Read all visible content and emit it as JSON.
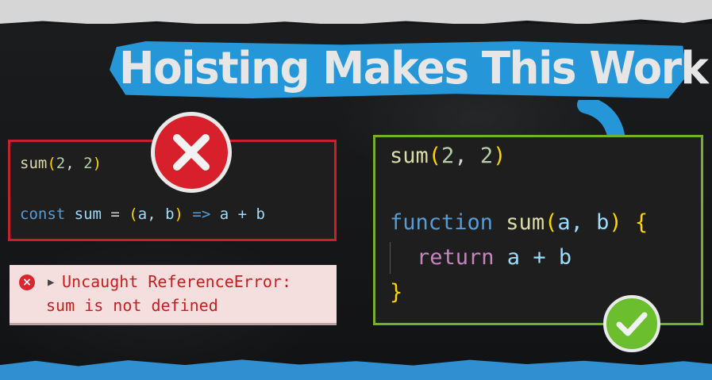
{
  "title": "Hoisting Makes This Work",
  "bad_code": {
    "line1": {
      "fn": "sum",
      "open": "(",
      "a": "2",
      "sep": ", ",
      "b": "2",
      "close": ")"
    },
    "line2": {
      "kw": "const",
      "name": " sum ",
      "eq": "= ",
      "open": "(",
      "p": "a, b",
      "close": ")",
      "arrow": " => ",
      "body": "a + b"
    }
  },
  "good_code": {
    "line1": {
      "fn": "sum",
      "open": "(",
      "a": "2",
      "sep": ", ",
      "b": "2",
      "close": ")"
    },
    "line2": {
      "kw": "function",
      "name": " sum",
      "open": "(",
      "p": "a, b",
      "close": ")",
      "brace": " {"
    },
    "line3": {
      "kw": "return",
      "body": " a + b"
    },
    "line4": {
      "brace": "}"
    }
  },
  "error": {
    "line1": "Uncaught ReferenceError:",
    "line2": "sum is not defined"
  },
  "colors": {
    "accent_blue": "#2597d8",
    "error_red": "#c8202f",
    "success_green": "#74b02c"
  },
  "icons": [
    "x-icon",
    "check-icon",
    "arrow-down-icon",
    "error-icon",
    "expand-triangle-icon"
  ]
}
